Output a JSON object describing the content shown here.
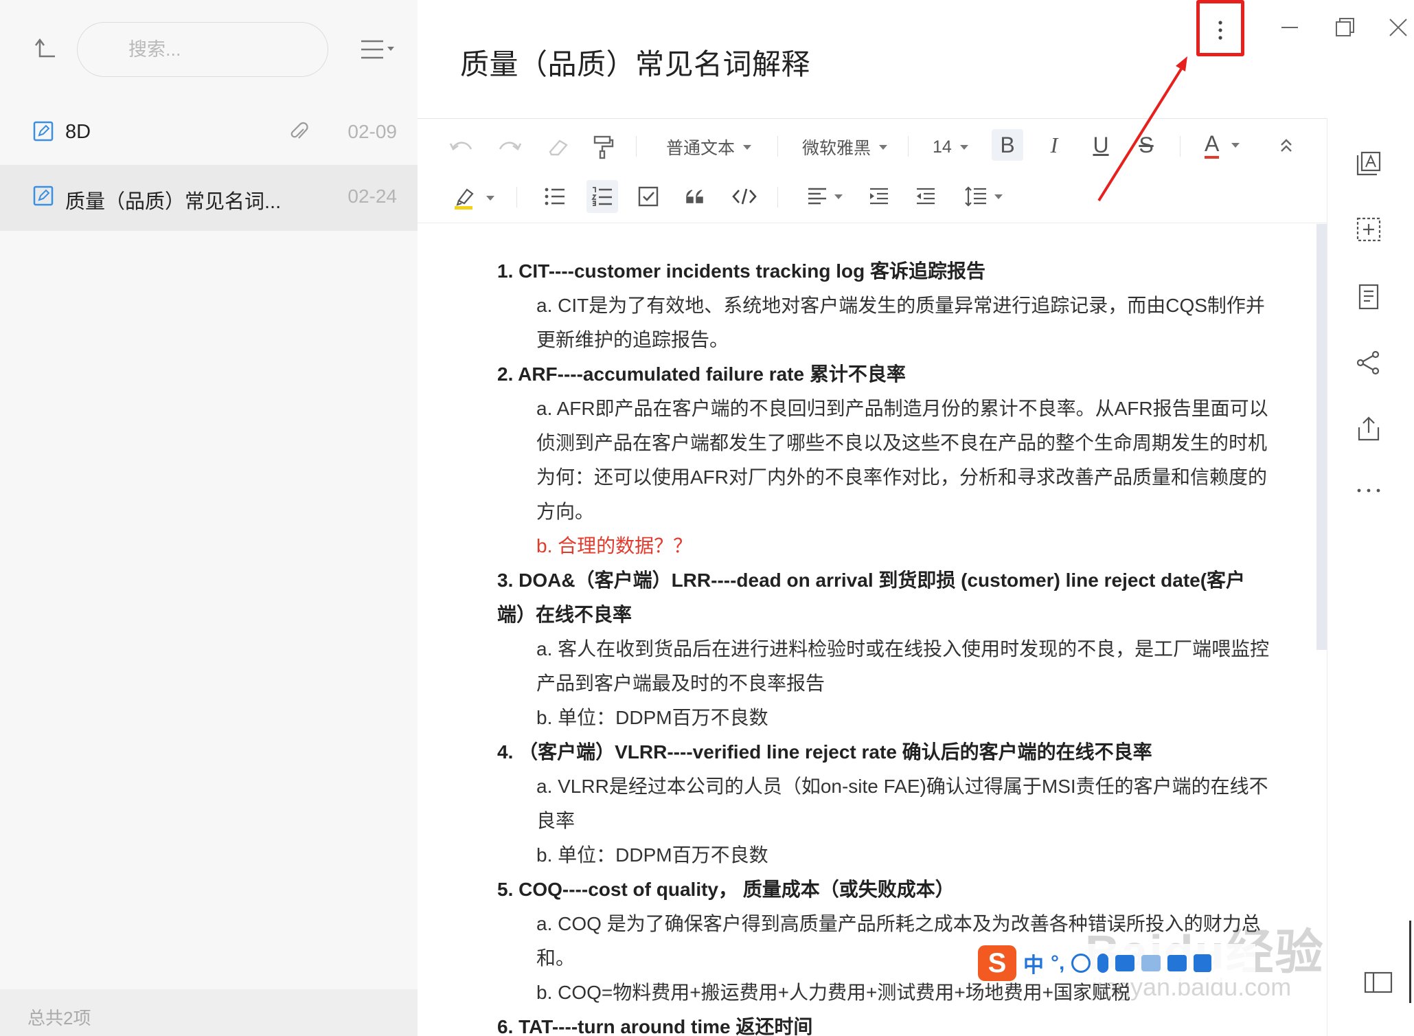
{
  "sidebar": {
    "search_placeholder": "搜索...",
    "notes": [
      {
        "title": "8D",
        "date": "02-09",
        "has_attachment": true
      },
      {
        "title": "质量（品质）常见名词...",
        "date": "02-24",
        "selected": true
      }
    ],
    "footer": "总共2项"
  },
  "editor": {
    "title": "质量（品质）常见名词解释",
    "toolbar": {
      "paragraph_style": "普通文本",
      "font_family": "微软雅黑",
      "font_size": "14",
      "bold": "B",
      "italic": "I",
      "underline": "U",
      "strike": "S",
      "font_color": "A"
    }
  },
  "content": {
    "lines": [
      "1. CIT----customer incidents tracking log 客诉追踪报告",
      "a. CIT是为了有效地、系统地对客户端发生的质量异常进行追踪记录，而由CQS制作并",
      "更新维护的追踪报告。",
      "2. ARF----accumulated failure rate 累计不良率",
      "a. AFR即产品在客户端的不良回归到产品制造月份的累计不良率。从AFR报告里面可以",
      "侦测到产品在客户端都发生了哪些不良以及这些不良在产品的整个生命周期发生的时机",
      "为何：还可以使用AFR对厂内外的不良率作对比，分析和寻求改善产品质量和信赖度的",
      "方向。",
      "b. 合理的数据？？",
      "3. DOA&（客户端）LRR----dead on arrival 到货即损 (customer) line reject date(客户",
      "端）在线不良率",
      "a. 客人在收到货品后在进行进料检验时或在线投入使用时发现的不良，是工厂端喂监控",
      "产品到客户端最及时的不良率报告",
      "b. 单位：DDPM百万不良数",
      "4. （客户端）VLRR----verified line reject rate 确认后的客户端的在线不良率",
      "a. VLRR是经过本公司的人员（如on-site FAE)确认过得属于MSI责任的客户端的在线不",
      "良率",
      "b. 单位：DDPM百万不良数",
      "5. COQ----cost of quality， 质量成本（或失败成本）",
      "a. COQ 是为了确保客户得到高质量产品所耗之成本及为改善各种错误所投入的财力总",
      "和。",
      "b. COQ=物料费用+搬运费用+人力费用+测试费用+场地费用+国家赋税",
      "6. TAT----turn around time 返还时间"
    ]
  },
  "overlay": {
    "ime_logo": "S",
    "ime_mode": "中",
    "ime_punct": "°,",
    "watermark_brand": "Baidu经验",
    "watermark_url": "jingyan.baidu.com"
  },
  "colors": {
    "annotation_red": "#e6211d",
    "highlight_red_text": "#e33a2c",
    "font_color_underline": "#e33a2c",
    "highlight_marker": "#f3d21c"
  }
}
